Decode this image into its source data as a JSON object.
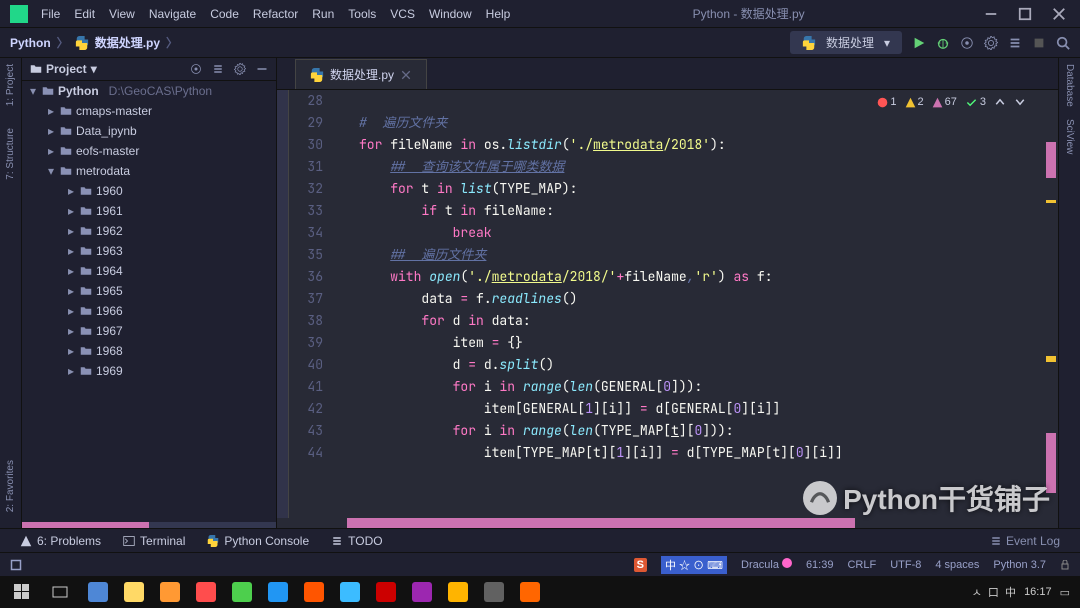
{
  "titlebar": {
    "menus": [
      "File",
      "Edit",
      "View",
      "Navigate",
      "Code",
      "Refactor",
      "Run",
      "Tools",
      "VCS",
      "Window",
      "Help"
    ],
    "title": "Python - 数据处理.py"
  },
  "breadcrumb": {
    "root": "Python",
    "file": "数据处理.py"
  },
  "run_config": {
    "name": "数据处理"
  },
  "project_panel": {
    "title": "Project",
    "root": {
      "name": "Python",
      "path": "D:\\GeoCAS\\Python"
    },
    "folders_l1": [
      "cmaps-master",
      "Data_ipynb",
      "eofs-master"
    ],
    "metrodata": "metrodata",
    "years": [
      "1960",
      "1961",
      "1962",
      "1963",
      "1964",
      "1965",
      "1966",
      "1967",
      "1968",
      "1969"
    ]
  },
  "left_stripes": [
    "1: Project",
    "7: Structure",
    "2: Favorites"
  ],
  "right_stripes": [
    "Database",
    "SciView"
  ],
  "tab": {
    "name": "数据处理.py"
  },
  "inspections": {
    "err": "1",
    "warn": "2",
    "weak": "67",
    "ok": "3"
  },
  "gutter_start": 28,
  "code": [
    [
      {
        "c": "empty",
        "t": ""
      }
    ],
    [
      {
        "c": "c-comment",
        "t": "#  遍历文件夹"
      }
    ],
    [
      {
        "c": "c-kw",
        "t": "for "
      },
      {
        "c": "",
        "t": "fileName "
      },
      {
        "c": "c-kw",
        "t": "in "
      },
      {
        "c": "",
        "t": "os."
      },
      {
        "c": "c-fn",
        "t": "listdir"
      },
      {
        "c": "",
        "t": "("
      },
      {
        "c": "c-str",
        "t": "'./"
      },
      {
        "c": "c-str c-ul",
        "t": "metrodata"
      },
      {
        "c": "c-str",
        "t": "/2018'"
      },
      {
        "c": "",
        "t": "):"
      }
    ],
    [
      {
        "c": "",
        "t": "    "
      },
      {
        "c": "c-comment c-ul",
        "t": "##  查询该文件属于哪类数据"
      }
    ],
    [
      {
        "c": "",
        "t": "    "
      },
      {
        "c": "c-kw",
        "t": "for "
      },
      {
        "c": "",
        "t": "t "
      },
      {
        "c": "c-kw",
        "t": "in "
      },
      {
        "c": "c-fn",
        "t": "list"
      },
      {
        "c": "",
        "t": "(TYPE_MAP):"
      }
    ],
    [
      {
        "c": "",
        "t": "        "
      },
      {
        "c": "c-kw",
        "t": "if "
      },
      {
        "c": "",
        "t": "t "
      },
      {
        "c": "c-kw",
        "t": "in "
      },
      {
        "c": "",
        "t": "fileName:"
      }
    ],
    [
      {
        "c": "",
        "t": "            "
      },
      {
        "c": "c-kw",
        "t": "break"
      }
    ],
    [
      {
        "c": "",
        "t": "    "
      },
      {
        "c": "c-comment c-ul",
        "t": "##  遍历文件夹"
      }
    ],
    [
      {
        "c": "",
        "t": "    "
      },
      {
        "c": "c-kw",
        "t": "with "
      },
      {
        "c": "c-fn",
        "t": "open"
      },
      {
        "c": "",
        "t": "("
      },
      {
        "c": "c-str",
        "t": "'./"
      },
      {
        "c": "c-str c-ul",
        "t": "metrodata"
      },
      {
        "c": "c-str",
        "t": "/2018/'"
      },
      {
        "c": "c-op",
        "t": "+"
      },
      {
        "c": "",
        "t": "fileName"
      },
      {
        "c": "c-comment",
        "t": ","
      },
      {
        "c": "c-str",
        "t": "'r'"
      },
      {
        "c": "",
        "t": ") "
      },
      {
        "c": "c-kw",
        "t": "as "
      },
      {
        "c": "",
        "t": "f:"
      }
    ],
    [
      {
        "c": "",
        "t": "        data "
      },
      {
        "c": "c-op",
        "t": "="
      },
      {
        "c": "",
        "t": " f."
      },
      {
        "c": "c-fn",
        "t": "readlines"
      },
      {
        "c": "",
        "t": "()"
      }
    ],
    [
      {
        "c": "",
        "t": "        "
      },
      {
        "c": "c-kw",
        "t": "for "
      },
      {
        "c": "",
        "t": "d "
      },
      {
        "c": "c-kw",
        "t": "in "
      },
      {
        "c": "",
        "t": "data:"
      }
    ],
    [
      {
        "c": "",
        "t": "            item "
      },
      {
        "c": "c-op",
        "t": "="
      },
      {
        "c": "",
        "t": " {}"
      }
    ],
    [
      {
        "c": "",
        "t": "            d "
      },
      {
        "c": "c-op",
        "t": "="
      },
      {
        "c": "",
        "t": " d."
      },
      {
        "c": "c-fn",
        "t": "split"
      },
      {
        "c": "",
        "t": "()"
      }
    ],
    [
      {
        "c": "",
        "t": "            "
      },
      {
        "c": "c-kw",
        "t": "for "
      },
      {
        "c": "",
        "t": "i "
      },
      {
        "c": "c-kw",
        "t": "in "
      },
      {
        "c": "c-fn",
        "t": "range"
      },
      {
        "c": "",
        "t": "("
      },
      {
        "c": "c-fn",
        "t": "len"
      },
      {
        "c": "",
        "t": "(GENERAL["
      },
      {
        "c": "c-num",
        "t": "0"
      },
      {
        "c": "",
        "t": "])):"
      }
    ],
    [
      {
        "c": "",
        "t": "                item[GENERAL["
      },
      {
        "c": "c-num",
        "t": "1"
      },
      {
        "c": "",
        "t": "][i]] "
      },
      {
        "c": "c-op",
        "t": "="
      },
      {
        "c": "",
        "t": " d[GENERAL["
      },
      {
        "c": "c-num",
        "t": "0"
      },
      {
        "c": "",
        "t": "][i]]"
      }
    ],
    [
      {
        "c": "",
        "t": "            "
      },
      {
        "c": "c-kw",
        "t": "for "
      },
      {
        "c": "",
        "t": "i "
      },
      {
        "c": "c-kw",
        "t": "in "
      },
      {
        "c": "c-fn",
        "t": "range"
      },
      {
        "c": "",
        "t": "("
      },
      {
        "c": "c-fn",
        "t": "len"
      },
      {
        "c": "",
        "t": "(TYPE_MAP["
      },
      {
        "c": "c-ul",
        "t": "t"
      },
      {
        "c": "",
        "t": "]["
      },
      {
        "c": "c-num",
        "t": "0"
      },
      {
        "c": "",
        "t": "])):"
      }
    ],
    [
      {
        "c": "",
        "t": "                item[TYPE_MAP[t]["
      },
      {
        "c": "c-num",
        "t": "1"
      },
      {
        "c": "",
        "t": "][i]] "
      },
      {
        "c": "c-op",
        "t": "="
      },
      {
        "c": "",
        "t": " d[TYPE_MAP[t]["
      },
      {
        "c": "c-num",
        "t": "0"
      },
      {
        "c": "",
        "t": "][i]]"
      }
    ]
  ],
  "toolwindow": {
    "problems": "6: Problems",
    "terminal": "Terminal",
    "console": "Python Console",
    "todo": "TODO"
  },
  "status": {
    "ime": "中 ☆ ⊙ ⌨",
    "theme": "Dracula",
    "line_col": "61:39",
    "line_sep": "CRLF",
    "encoding": "UTF-8",
    "indent": "4 spaces",
    "interpreter": "Python 3.7",
    "event_log": "Event Log"
  },
  "taskbar": {
    "time": "16:17"
  },
  "watermark": "Python干货铺子"
}
